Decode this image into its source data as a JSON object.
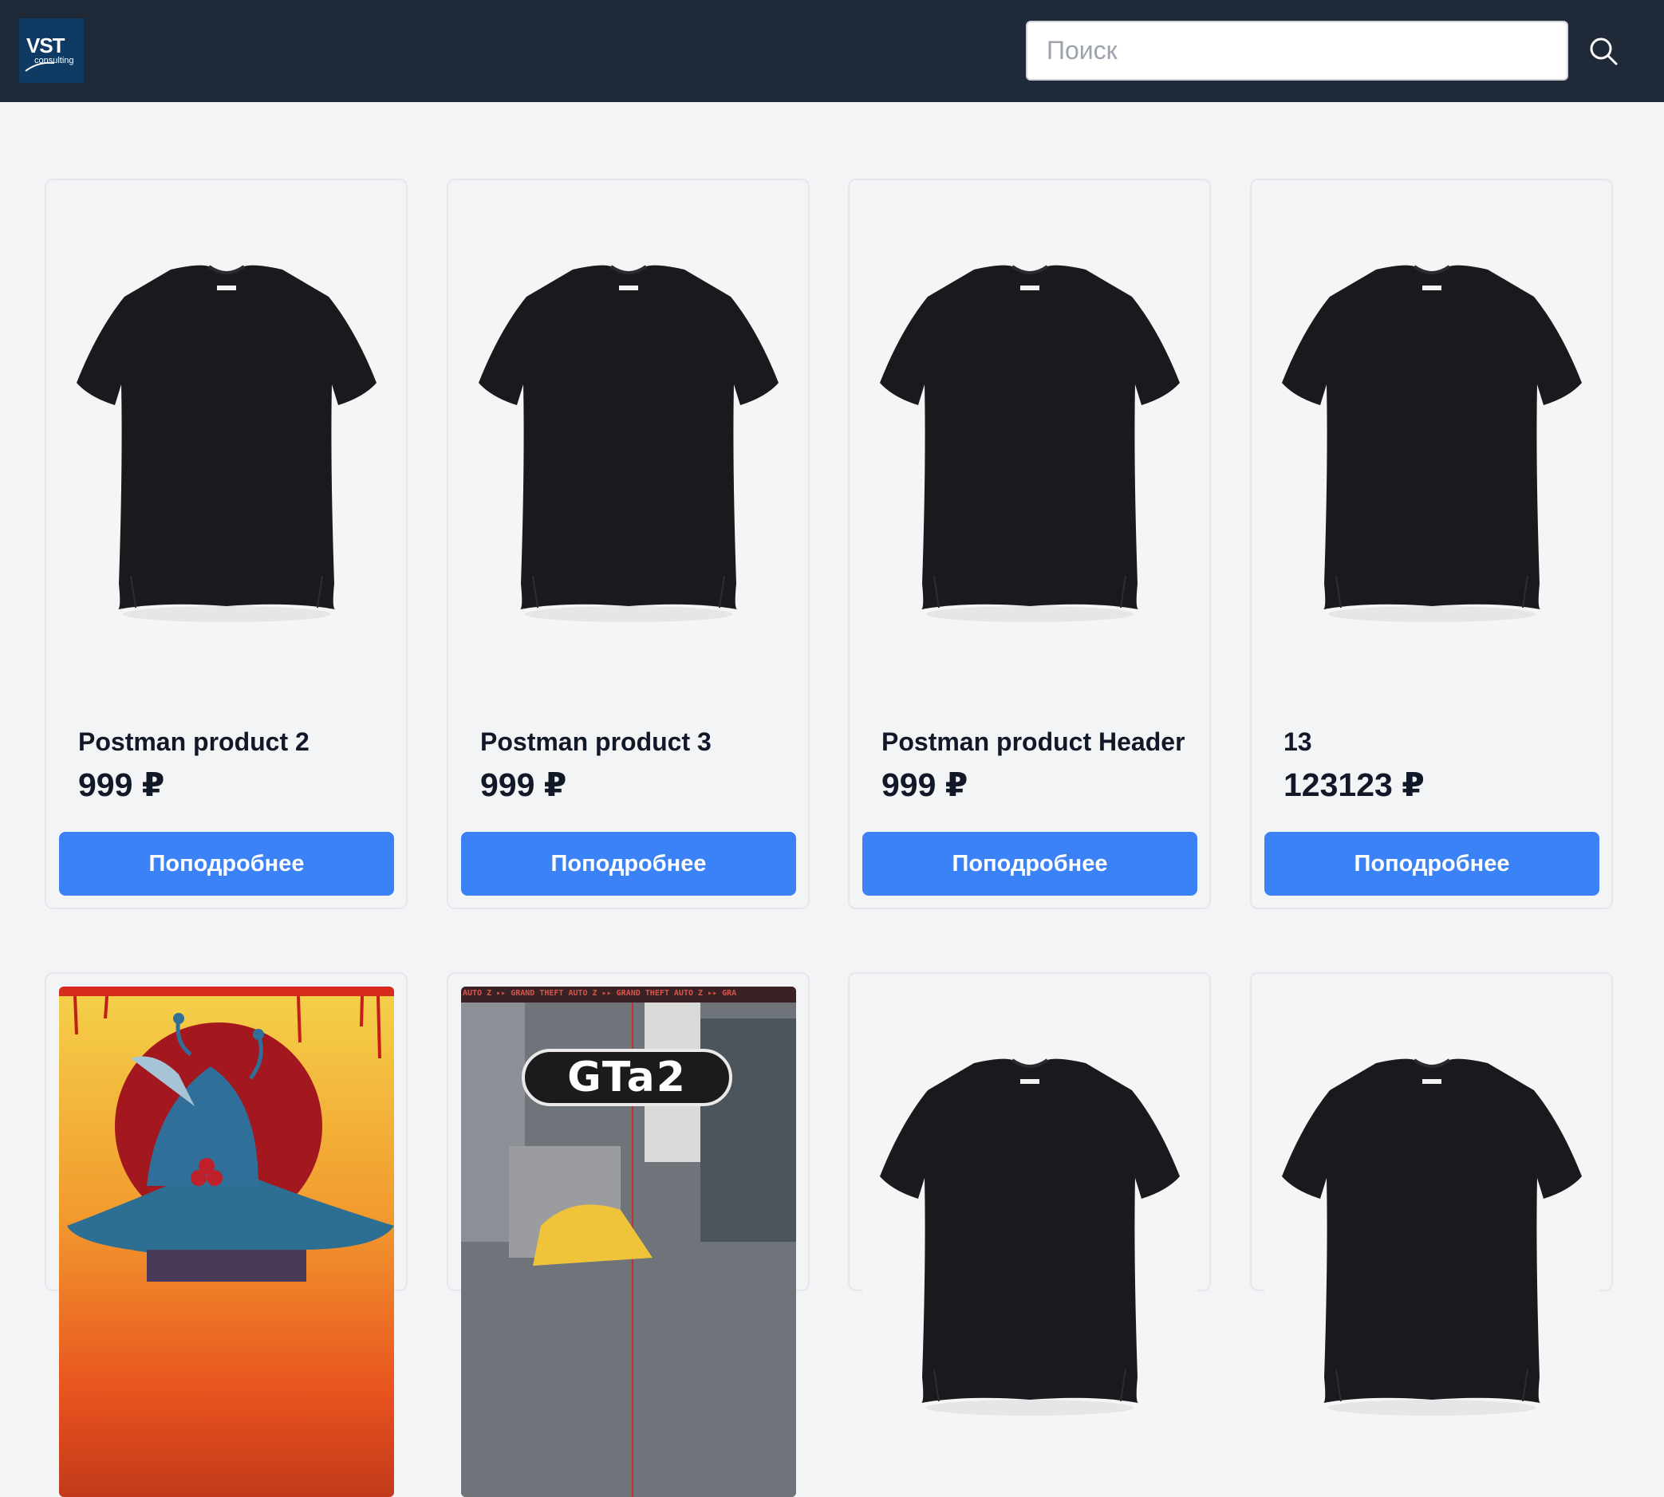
{
  "header": {
    "logo_text": "VST",
    "logo_subtext": "consulting",
    "search_placeholder": "Поиск"
  },
  "products": [
    {
      "title": "Postman product 2",
      "price": "999 ₽",
      "button": "Поподробнее",
      "image": "black-tshirt"
    },
    {
      "title": "Postman product 3",
      "price": "999 ₽",
      "button": "Поподробнее",
      "image": "black-tshirt"
    },
    {
      "title": "Postman product Header",
      "price": "999 ₽",
      "button": "Поподробнее",
      "image": "black-tshirt"
    },
    {
      "title": "13",
      "price": "123123 ₽",
      "button": "Поподробнее",
      "image": "black-tshirt"
    },
    {
      "image": "painting-art"
    },
    {
      "image": "gta2-cover",
      "image_text": "GTa2",
      "image_banner": "AUTO Z ▸▸ GRAND THEFT AUTO Z ▸▸ GRAND THEFT AUTO Z ▸▸ GRA"
    },
    {
      "image": "black-tshirt"
    },
    {
      "image": "black-tshirt"
    }
  ],
  "colors": {
    "header_bg": "#1f2937",
    "page_bg": "#f3f4f6",
    "button_bg": "#3b82f6",
    "logo_bg": "#0e3a63"
  }
}
